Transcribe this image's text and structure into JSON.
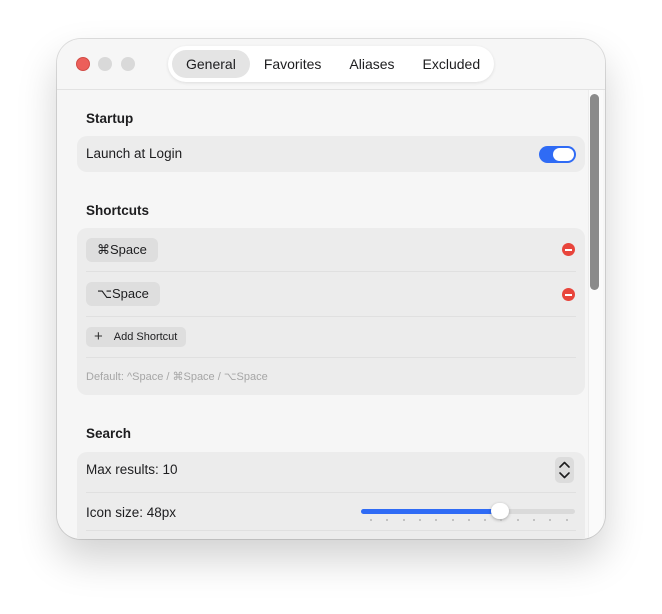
{
  "window": {
    "tabs": [
      {
        "label": "General",
        "active": true
      },
      {
        "label": "Favorites",
        "active": false
      },
      {
        "label": "Aliases",
        "active": false
      },
      {
        "label": "Excluded",
        "active": false
      }
    ]
  },
  "startup": {
    "title": "Startup",
    "launch_label": "Launch at Login",
    "launch_enabled": true
  },
  "shortcuts": {
    "title": "Shortcuts",
    "items": [
      "⌘Space",
      "⌥Space"
    ],
    "add_label": "Add Shortcut",
    "default_hint": "Default: ^Space / ⌘Space / ⌥Space"
  },
  "search": {
    "title": "Search",
    "max_results_label": "Max results: 10",
    "max_results": 10,
    "icon_size_label": "Icon size: 48px",
    "icon_size_fraction": 0.65
  },
  "colors": {
    "accent": "#2f6bf5",
    "remove": "#e8453c"
  }
}
